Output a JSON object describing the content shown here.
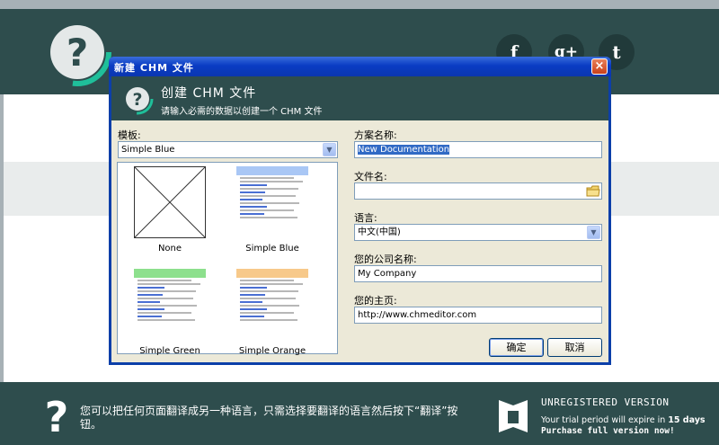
{
  "dialog": {
    "title": "新建 CHM 文件",
    "banner_title": "创建 CHM 文件",
    "banner_subtitle": "请输入必需的数据以创建一个 CHM 文件",
    "template_label": "模板:",
    "template_value": "Simple Blue",
    "templates": [
      {
        "name": "None"
      },
      {
        "name": "Simple Blue",
        "accent": "#a9c7f5"
      },
      {
        "name": "Simple Green",
        "accent": "#8de08d"
      },
      {
        "name": "Simple Orange",
        "accent": "#f7c98a"
      }
    ],
    "project_name_label": "方案名称:",
    "project_name_value": "New Documentation",
    "filename_label": "文件名:",
    "filename_value": "",
    "language_label": "语言:",
    "language_value": "中文(中国)",
    "company_label": "您的公司名称:",
    "company_value": "My Company",
    "homepage_label": "您的主页:",
    "homepage_value": "http://www.chmeditor.com",
    "ok_label": "确定",
    "cancel_label": "取消",
    "close_glyph": "×"
  },
  "social": {
    "facebook": "f",
    "google": "g+",
    "twitter": "t"
  },
  "footer": {
    "tip": "您可以把任何页面翻译成另一种语言，只需选择要翻译的语言然后按下“翻译”按钮。",
    "unregistered": "UNREGISTERED VERSION",
    "trial_text": "Your trial period will expire in",
    "trial_days": "15 days",
    "purchase": "Purchase full version now!"
  },
  "colors": {
    "header": "#2e4d4d",
    "accent": "#1fbf9a",
    "titlebar": "#0a3cc4"
  }
}
